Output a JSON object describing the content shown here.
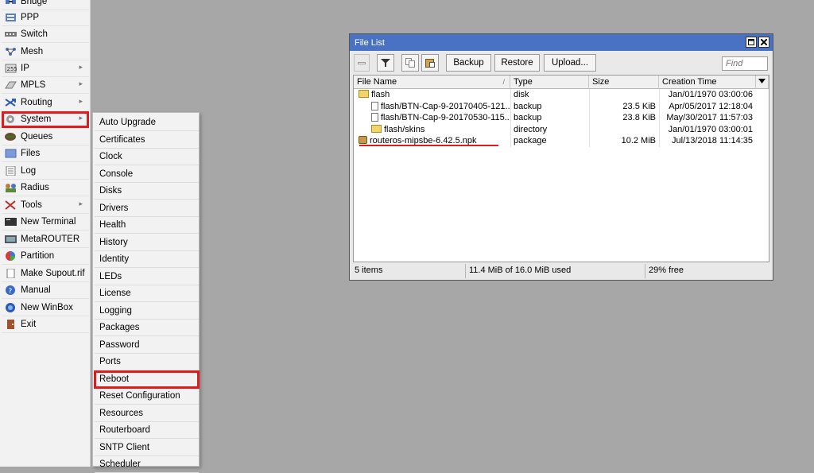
{
  "menu": {
    "items": [
      {
        "label": "Bridge",
        "icon": "bridge-icon"
      },
      {
        "label": "PPP",
        "icon": "ppp-icon"
      },
      {
        "label": "Switch",
        "icon": "switch-icon"
      },
      {
        "label": "Mesh",
        "icon": "mesh-icon"
      },
      {
        "label": "IP",
        "icon": "ip-icon"
      },
      {
        "label": "MPLS",
        "icon": "mpls-icon"
      },
      {
        "label": "Routing",
        "icon": "routing-icon"
      },
      {
        "label": "System",
        "icon": "gear-icon"
      },
      {
        "label": "Queues",
        "icon": "queues-icon"
      },
      {
        "label": "Files",
        "icon": "folder-icon"
      },
      {
        "label": "Log",
        "icon": "log-icon"
      },
      {
        "label": "Radius",
        "icon": "radius-icon"
      },
      {
        "label": "Tools",
        "icon": "tools-icon"
      },
      {
        "label": "New Terminal",
        "icon": "terminal-icon"
      },
      {
        "label": "MetaROUTER",
        "icon": "metarouter-icon"
      },
      {
        "label": "Partition",
        "icon": "partition-icon"
      },
      {
        "label": "Make Supout.rif",
        "icon": "document-icon"
      },
      {
        "label": "Manual",
        "icon": "help-icon"
      },
      {
        "label": "New WinBox",
        "icon": "winbox-icon"
      },
      {
        "label": "Exit",
        "icon": "exit-icon"
      }
    ],
    "submenu_arrow": "▸"
  },
  "submenu": {
    "items": [
      "Auto Upgrade",
      "Certificates",
      "Clock",
      "Console",
      "Disks",
      "Drivers",
      "Health",
      "History",
      "Identity",
      "LEDs",
      "License",
      "Logging",
      "Packages",
      "Password",
      "Ports",
      "Reboot",
      "Reset Configuration",
      "Resources",
      "Routerboard",
      "SNTP Client",
      "Scheduler"
    ]
  },
  "window": {
    "title": "File List",
    "toolbar": {
      "backup": "Backup",
      "restore": "Restore",
      "upload": "Upload...",
      "find_placeholder": "Find"
    },
    "columns": [
      "File Name",
      "Type",
      "Size",
      "Creation Time"
    ],
    "rows": [
      {
        "name": "flash",
        "type": "disk",
        "size": "",
        "time": "Jan/01/1970 03:00:06",
        "icon": "folder",
        "indent": 0
      },
      {
        "name": "flash/BTN-Cap-9-20170405-121...",
        "type": "backup",
        "size": "23.5 KiB",
        "time": "Apr/05/2017 12:18:04",
        "icon": "file",
        "indent": 1
      },
      {
        "name": "flash/BTN-Cap-9-20170530-115...",
        "type": "backup",
        "size": "23.8 KiB",
        "time": "May/30/2017 11:57:03",
        "icon": "file",
        "indent": 1
      },
      {
        "name": "flash/skins",
        "type": "directory",
        "size": "",
        "time": "Jan/01/1970 03:00:01",
        "icon": "folder",
        "indent": 1
      },
      {
        "name": "routeros-mipsbe-6.42.5.npk",
        "type": "package",
        "size": "10.2 MiB",
        "time": "Jul/13/2018 11:14:35",
        "icon": "package",
        "indent": 0
      }
    ],
    "status": {
      "items": "5 items",
      "used": "11.4 MiB of 16.0 MiB used",
      "free": "29% free"
    }
  },
  "colors": {
    "highlight": "#d81e1e",
    "titlebar": "#4a72c4",
    "desktop": "#a7a7a7"
  }
}
